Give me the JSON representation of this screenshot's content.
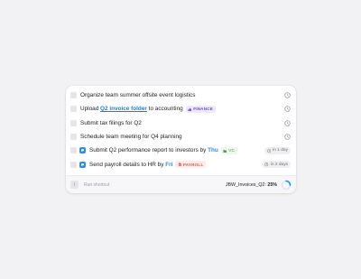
{
  "tasks": [
    {
      "text": "Organize team summer offsite event logistics"
    },
    {
      "text_before": "Upload ",
      "link": "Q2 invoice folder",
      "text_after": " to accounting",
      "tag": "FINANCE",
      "tag_icon": "thumbs-up-icon"
    },
    {
      "text": "Submit tax filings for Q2"
    },
    {
      "text": "Schedule team meeting for Q4 planning"
    },
    {
      "text_before": "Submit Q2 performance report to investors by ",
      "day": "Thu",
      "tag": "VC",
      "tag_icon": "folder-icon",
      "due": "in 1 day"
    },
    {
      "text_before": "Send payroll details to HR by ",
      "day": "Fri",
      "tag": "PAYROLL",
      "tag_icon": "document-icon",
      "due": "in 2 days"
    }
  ],
  "footer": {
    "shortcut_key": "/",
    "shortcut_label": "Run shortcut",
    "progress_name": "JBW_Invoices_Q2: ",
    "progress_value": "25%",
    "progress_fraction": 0.25
  },
  "colors": {
    "accent_blue": "#1c7ed6",
    "finance_purple": "#6b4de0",
    "payroll_red": "#e35b52",
    "vc_green": "#3f9f49"
  }
}
